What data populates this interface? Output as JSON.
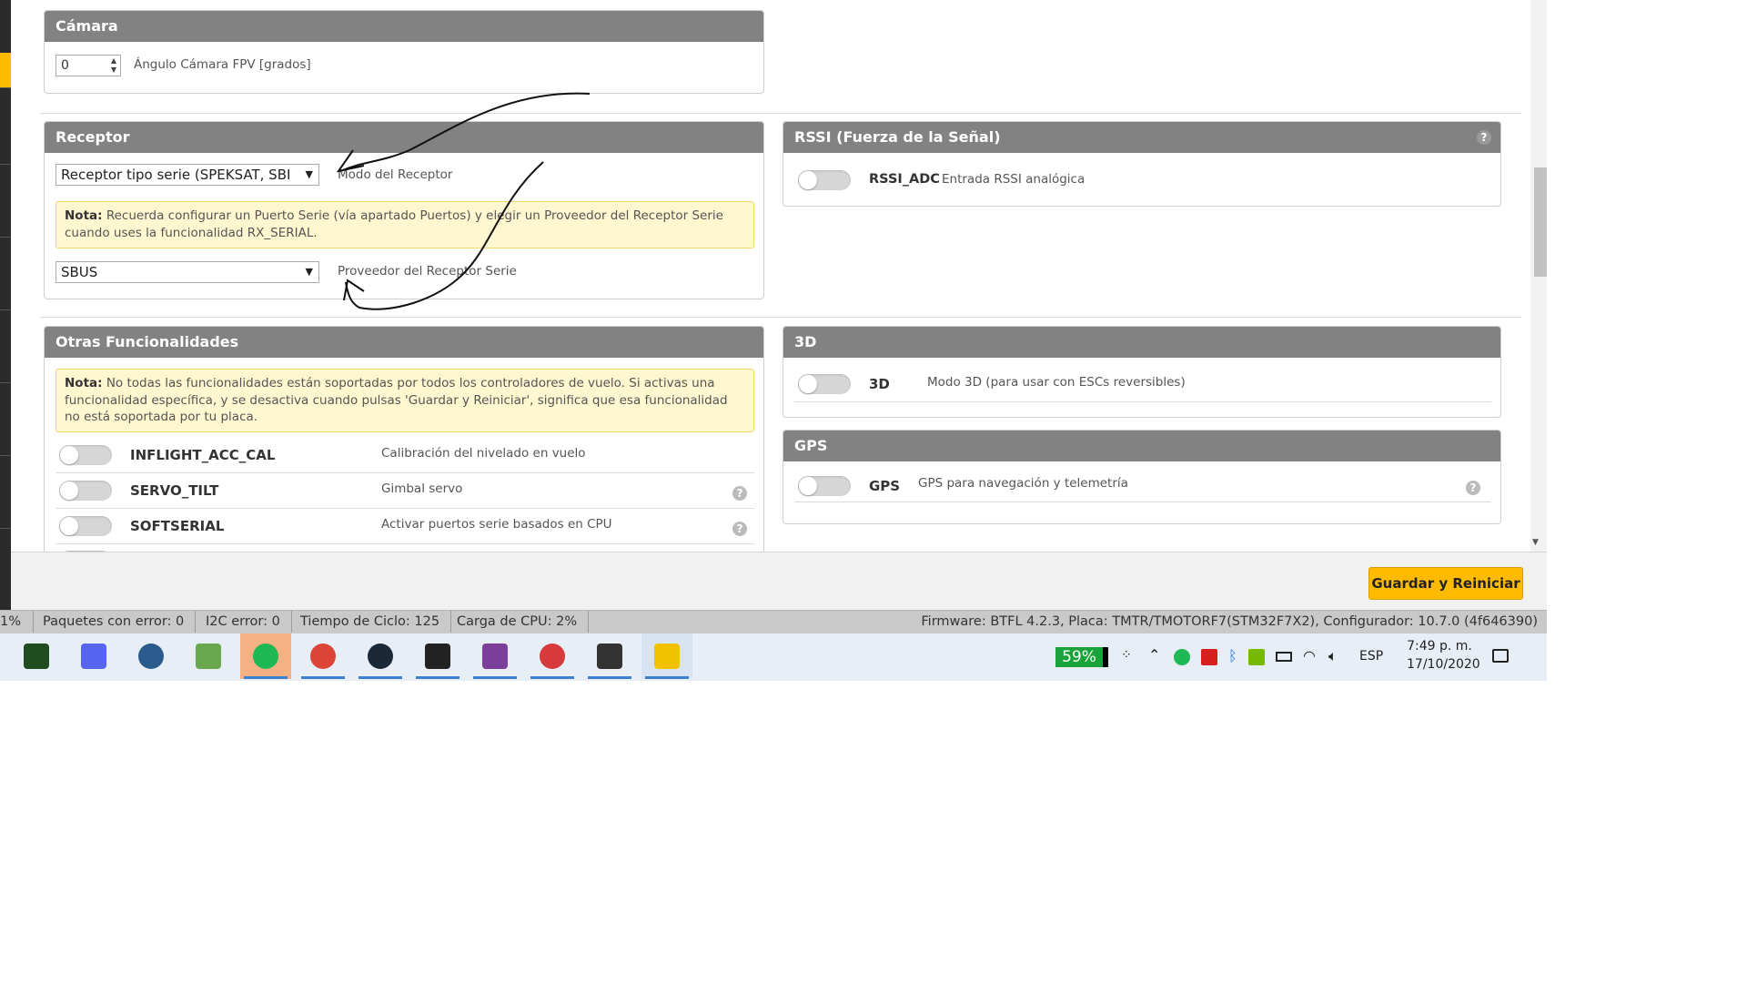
{
  "camera": {
    "title": "Cámara",
    "angle_value": "0",
    "angle_label": "Ángulo Cámara FPV [grados]"
  },
  "receiver": {
    "title": "Receptor",
    "mode_value": "Receptor tipo serie (SPEKSAT, SBI",
    "mode_label": "Modo del Receptor",
    "note_bold": "Nota:",
    "note_text": " Recuerda configurar un Puerto Serie (vía apartado Puertos) y elegir un Proveedor del Receptor Serie cuando uses la funcionalidad RX_SERIAL.",
    "provider_value": "SBUS",
    "provider_label": "Proveedor del Receptor Serie"
  },
  "rssi": {
    "title": "RSSI (Fuerza de la Señal)",
    "help": "?",
    "name": "RSSI_ADC",
    "desc": "Entrada RSSI analógica"
  },
  "other": {
    "title": "Otras Funcionalidades",
    "note_bold": "Nota:",
    "note_text": " No todas las funcionalidades están soportadas por todos los controladores de vuelo. Si activas una funcionalidad específica, y se desactiva cuando pulsas 'Guardar y Reiniciar', significa que esa funcionalidad no está soportada por tu placa.",
    "features": [
      {
        "name": "INFLIGHT_ACC_CAL",
        "desc": "Calibración del nivelado en vuelo",
        "help": ""
      },
      {
        "name": "SERVO_TILT",
        "desc": "Gimbal servo",
        "help": "?"
      },
      {
        "name": "SOFTSERIAL",
        "desc": "Activar puertos serie basados en CPU",
        "help": "?"
      }
    ]
  },
  "threed": {
    "title": "3D",
    "name": "3D",
    "desc": "Modo 3D (para usar con ESCs reversibles)"
  },
  "gps": {
    "title": "GPS",
    "name": "GPS",
    "desc": "GPS para navegación y telemetría",
    "help": "?"
  },
  "save_button": "Guardar y Reiniciar",
  "status": {
    "packet_pct": "1%",
    "packet_errors": "Paquetes con error: 0",
    "i2c_errors": "I2C error: 0",
    "cycle_time": "Tiempo de Ciclo: 125",
    "cpu_load": "Carga de CPU: 2%",
    "firmware": "Firmware: BTFL 4.2.3, Placa: TMTR/TMOTORF7(STM32F7X2), Configurador: 10.7.0 (4f646390)"
  },
  "taskbar": {
    "apps": [
      {
        "icon": "game-app-icon",
        "color": "#1f4d1f"
      },
      {
        "icon": "discord-icon",
        "color": "#5865f2"
      },
      {
        "icon": "headset-app-icon",
        "color": "#2a5b8c"
      },
      {
        "icon": "notepad-app-icon",
        "color": "#6aa84f"
      },
      {
        "icon": "spotify-icon",
        "color": "#1db954"
      },
      {
        "icon": "chrome-icon",
        "color": "#db4437"
      },
      {
        "icon": "steam-icon",
        "color": "#1b2838"
      },
      {
        "icon": "photos-icon",
        "color": "#222222"
      },
      {
        "icon": "winrar-icon",
        "color": "#7b3f99"
      },
      {
        "icon": "dx-app-icon",
        "color": "#d63a3a"
      },
      {
        "icon": "calculator-icon",
        "color": "#333333"
      },
      {
        "icon": "betaflight-icon",
        "color": "#f2c200"
      }
    ],
    "battery": "59%",
    "language": "ESP",
    "time": "7:49 p. m.",
    "date": "17/10/2020"
  }
}
